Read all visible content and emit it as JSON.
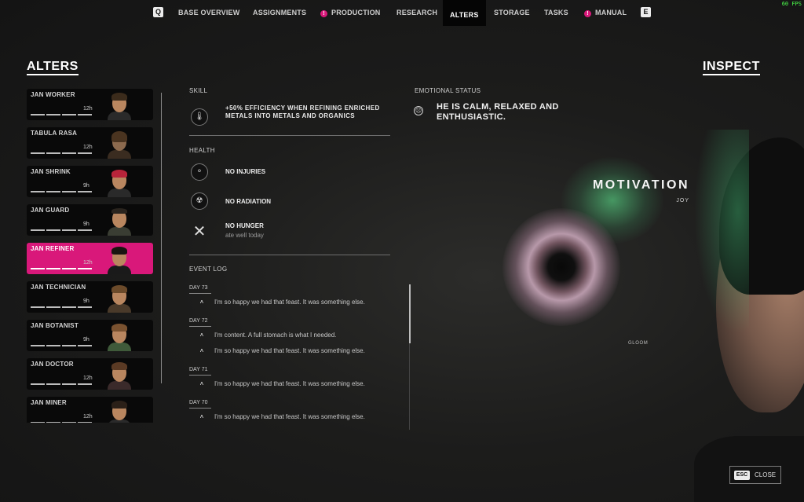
{
  "fps": "60 FPS",
  "nav": {
    "key_left": "Q",
    "key_right": "E",
    "tabs": [
      {
        "label": "BASE OVERVIEW"
      },
      {
        "label": "ASSIGNMENTS"
      },
      {
        "label": "PRODUCTION",
        "alert": "!"
      },
      {
        "label": "RESEARCH"
      },
      {
        "label": "ALTERS",
        "active": true
      },
      {
        "label": "STORAGE"
      },
      {
        "label": "TASKS"
      },
      {
        "label": "MANUAL",
        "alert": "!"
      }
    ]
  },
  "alters": {
    "title": "ALTERS",
    "items": [
      {
        "name": "JAN WORKER",
        "hours": "12h",
        "selected": false
      },
      {
        "name": "TABULA RASA",
        "hours": "12h",
        "selected": false
      },
      {
        "name": "JAN SHRINK",
        "hours": "9h",
        "selected": false
      },
      {
        "name": "JAN GUARD",
        "hours": "9h",
        "selected": false
      },
      {
        "name": "JAN REFINER",
        "hours": "12h",
        "selected": true
      },
      {
        "name": "JAN TECHNICIAN",
        "hours": "9h",
        "selected": false
      },
      {
        "name": "JAN BOTANIST",
        "hours": "9h",
        "selected": false
      },
      {
        "name": "JAN DOCTOR",
        "hours": "12h",
        "selected": false
      },
      {
        "name": "JAN MINER",
        "hours": "12h",
        "selected": false
      }
    ]
  },
  "skill": {
    "label": "SKILL",
    "text": "+50% EFFICIENCY WHEN REFINING ENRICHED METALS INTO METALS AND ORGANICS"
  },
  "health": {
    "label": "HEALTH",
    "injuries": "NO INJURIES",
    "radiation": "NO RADIATION",
    "hunger": "NO HUNGER",
    "hunger_sub": "ate well today"
  },
  "event_log": {
    "label": "EVENT LOG",
    "days": [
      {
        "day": "DAY 73",
        "entries": [
          "I'm so happy we had that feast. It was something else."
        ]
      },
      {
        "day": "DAY 72",
        "entries": [
          "I'm content. A full stomach is what I needed.",
          "I'm so happy we had that feast. It was something else."
        ]
      },
      {
        "day": "DAY 71",
        "entries": [
          "I'm so happy we had that feast. It was something else."
        ]
      },
      {
        "day": "DAY 70",
        "entries": [
          "I'm so happy we had that feast. It was something else."
        ]
      }
    ]
  },
  "emotional": {
    "label": "EMOTIONAL STATUS",
    "icon": "☹",
    "text": "HE IS CALM, RELAXED AND ENTHUSIASTIC."
  },
  "inspect": {
    "title": "INSPECT",
    "motivation": "MOTIVATION",
    "motivation_sub": "JOY",
    "gloom": "GLOOM"
  },
  "close": {
    "key": "ESC",
    "label": "CLOSE"
  },
  "colors": {
    "accent": "#d9187a",
    "background": "#1c1c1b"
  }
}
